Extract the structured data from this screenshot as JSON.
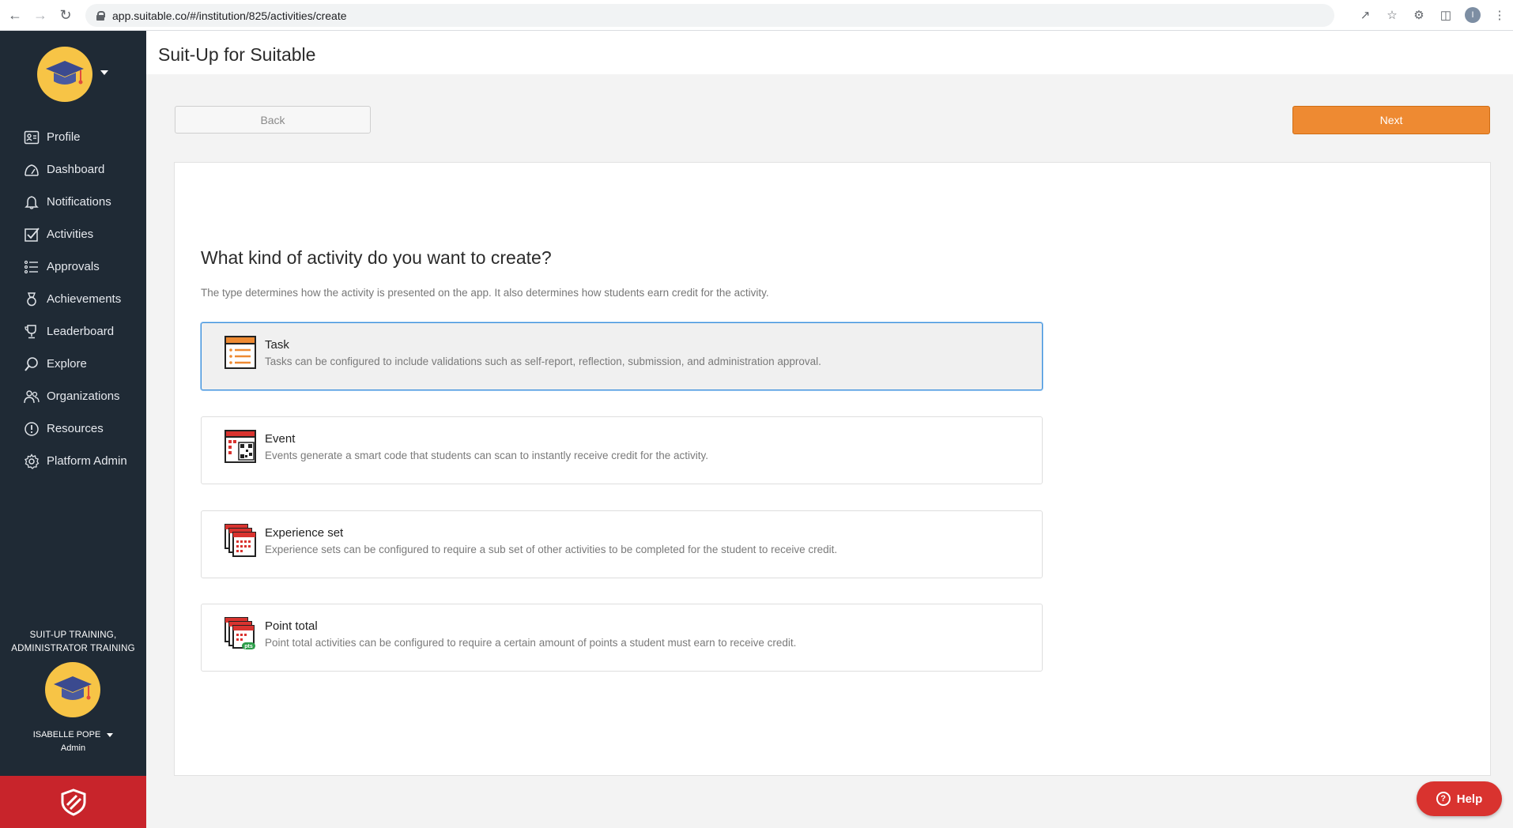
{
  "browser": {
    "url": "app.suitable.co/#/institution/825/activities/create",
    "profile_initial": "I"
  },
  "sidebar": {
    "items": [
      {
        "label": "Profile",
        "icon": "id-card-icon"
      },
      {
        "label": "Dashboard",
        "icon": "dashboard-icon"
      },
      {
        "label": "Notifications",
        "icon": "bell-icon"
      },
      {
        "label": "Activities",
        "icon": "checkbox-icon"
      },
      {
        "label": "Approvals",
        "icon": "list-check-icon"
      },
      {
        "label": "Achievements",
        "icon": "medal-icon"
      },
      {
        "label": "Leaderboard",
        "icon": "trophy-icon"
      },
      {
        "label": "Explore",
        "icon": "magnifier-icon"
      },
      {
        "label": "Organizations",
        "icon": "people-icon"
      },
      {
        "label": "Resources",
        "icon": "info-icon"
      },
      {
        "label": "Platform Admin",
        "icon": "gear-icon"
      }
    ],
    "org_line1": "SUIT-UP TRAINING,",
    "org_line2": "ADMINISTRATOR TRAINING",
    "user_name": "ISABELLE POPE",
    "user_role": "Admin"
  },
  "header": {
    "title": "Suit-Up for Suitable"
  },
  "toolbar": {
    "back_label": "Back",
    "next_label": "Next"
  },
  "main": {
    "question": "What kind of activity do you want to create?",
    "subtext": "The type determines how the activity is presented on the app. It also determines how students earn credit for the activity.",
    "options": [
      {
        "title": "Task",
        "description": "Tasks can be configured to include validations such as self-report, reflection, submission, and administration approval.",
        "selected": true
      },
      {
        "title": "Event",
        "description": "Events generate a smart code that students can scan to instantly receive credit for the activity.",
        "selected": false
      },
      {
        "title": "Experience set",
        "description": "Experience sets can be configured to require a sub set of other activities to be completed for the student to receive credit.",
        "selected": false
      },
      {
        "title": "Point total",
        "description": "Point total activities can be configured to require a certain amount of points a student must earn to receive credit.",
        "selected": false
      }
    ],
    "pts_badge": "pts"
  },
  "help": {
    "label": "Help"
  },
  "colors": {
    "sidebar_bg": "#1f2a35",
    "accent_orange": "#ee8a32",
    "brand_red": "#c8242b",
    "selection_blue": "#3c8fdc"
  }
}
